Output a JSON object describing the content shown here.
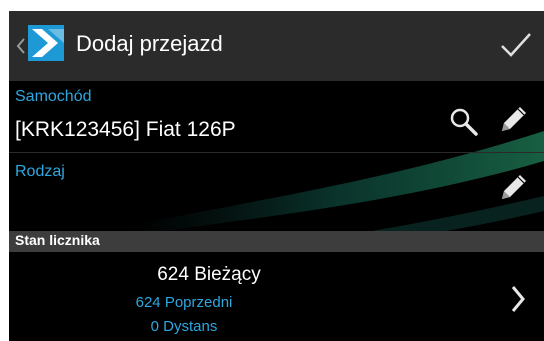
{
  "actionbar": {
    "title": "Dodaj przejazd",
    "back_icon": "chevron-left-icon",
    "logo_icon": "app-logo",
    "confirm_icon": "checkmark-icon"
  },
  "car": {
    "label": "Samochód",
    "value": "[KRK123456] Fiat 126P",
    "icons": [
      "search-icon",
      "pencil-icon"
    ]
  },
  "type": {
    "label": "Rodzaj",
    "value": "",
    "icons": [
      "pencil-icon"
    ]
  },
  "odometer": {
    "section_title": "Stan licznika",
    "current": "624 Bieżący",
    "previous": "624 Poprzedni",
    "distance": "0 Dystans",
    "action_icon": "chevron-right-icon"
  },
  "colors": {
    "accent": "#2ea7e0",
    "actionbar_bg": "#2b2b2b",
    "section_bg": "#3d3d3d",
    "background": "#000000"
  }
}
